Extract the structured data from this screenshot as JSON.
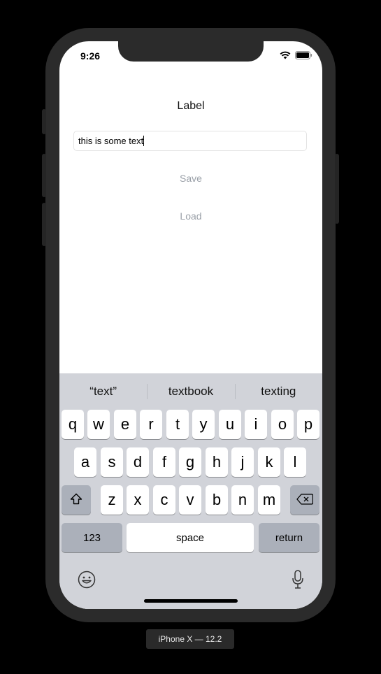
{
  "status_bar": {
    "time": "9:26"
  },
  "content": {
    "label": "Label",
    "text_field_value": "this is some text",
    "save_label": "Save",
    "load_label": "Load"
  },
  "keyboard": {
    "suggestions": [
      "“text”",
      "textbook",
      "texting"
    ],
    "rows": [
      [
        "q",
        "w",
        "e",
        "r",
        "t",
        "y",
        "u",
        "i",
        "o",
        "p"
      ],
      [
        "a",
        "s",
        "d",
        "f",
        "g",
        "h",
        "j",
        "k",
        "l"
      ],
      [
        "z",
        "x",
        "c",
        "v",
        "b",
        "n",
        "m"
      ]
    ],
    "numbers_label": "123",
    "space_label": "space",
    "return_label": "return"
  },
  "device_label": "iPhone X — 12.2"
}
